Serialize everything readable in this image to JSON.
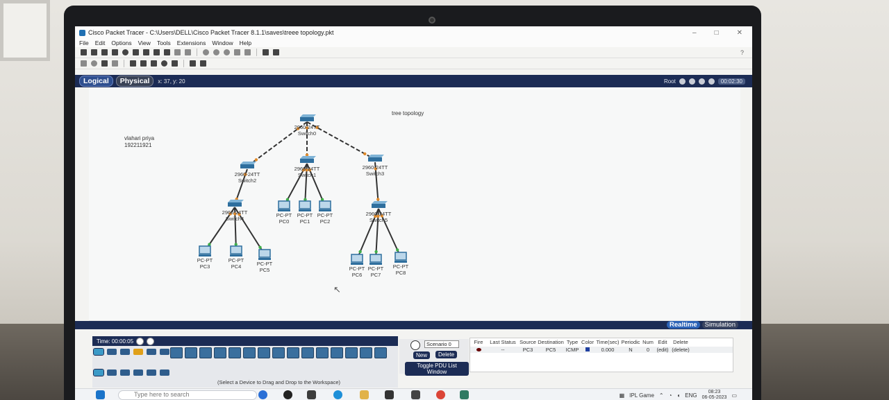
{
  "window": {
    "title": "Cisco Packet Tracer - C:\\Users\\DELL\\Cisco Packet Tracer 8.1.1\\saves\\treee topology.pkt"
  },
  "menu": [
    "File",
    "Edit",
    "Options",
    "View",
    "Tools",
    "Extensions",
    "Window",
    "Help"
  ],
  "help_label": "?",
  "modes": {
    "logical": "Logical",
    "physical": "Physical",
    "coords": "x: 37, y: 20"
  },
  "root_bar": {
    "label": "Root",
    "timer": "00:02:30"
  },
  "canvas": {
    "note_title": "tree topology",
    "note_name": "vlahari priya",
    "note_id": "192211921",
    "switches": [
      {
        "model": "2960-24TT",
        "name": "Switch0"
      },
      {
        "model": "2960-24TT",
        "name": "Switch1"
      },
      {
        "model": "2960-24TT",
        "name": "Switch2"
      },
      {
        "model": "2960-24TT",
        "name": "Switch3"
      },
      {
        "model": "2960-24TT",
        "name": "Switch4"
      },
      {
        "model": "2960-24TT",
        "name": "Switch5"
      }
    ],
    "pcs": [
      {
        "model": "PC-PT",
        "name": "PC0"
      },
      {
        "model": "PC-PT",
        "name": "PC1"
      },
      {
        "model": "PC-PT",
        "name": "PC2"
      },
      {
        "model": "PC-PT",
        "name": "PC3"
      },
      {
        "model": "PC-PT",
        "name": "PC4"
      },
      {
        "model": "PC-PT",
        "name": "PC5"
      },
      {
        "model": "PC-PT",
        "name": "PC6"
      },
      {
        "model": "PC-PT",
        "name": "PC7"
      },
      {
        "model": "PC-PT",
        "name": "PC8"
      }
    ]
  },
  "sim_tabs": {
    "realtime": "Realtime",
    "simulation": "Simulation"
  },
  "timebar": {
    "time": "Time: 00:00:05"
  },
  "device_hint": "(Select a Device to Drag and Drop to the Workspace)",
  "pdu": {
    "scenario": "Scenario 0",
    "new": "New",
    "delete": "Delete",
    "toggle": "Toggle PDU List Window",
    "headers": [
      "Fire",
      "Last Status",
      "Source",
      "Destination",
      "Type",
      "Color",
      "Time(sec)",
      "Periodic",
      "Num",
      "Edit",
      "Delete"
    ],
    "row": [
      "",
      "--",
      "PC3",
      "PC5",
      "ICMP",
      "",
      "0.000",
      "N",
      "0",
      "(edit)",
      "(delete)"
    ]
  },
  "taskbar": {
    "search_placeholder": "Type here to search",
    "game_label": "IPL Game",
    "lang": "ENG",
    "time": "08:23",
    "date": "06-05-2023"
  },
  "colors": {
    "mode_bar": "#1c2c55",
    "link": "#333333",
    "link_dot_amber": "#e08a2a",
    "link_dot_green": "#3fae49"
  }
}
